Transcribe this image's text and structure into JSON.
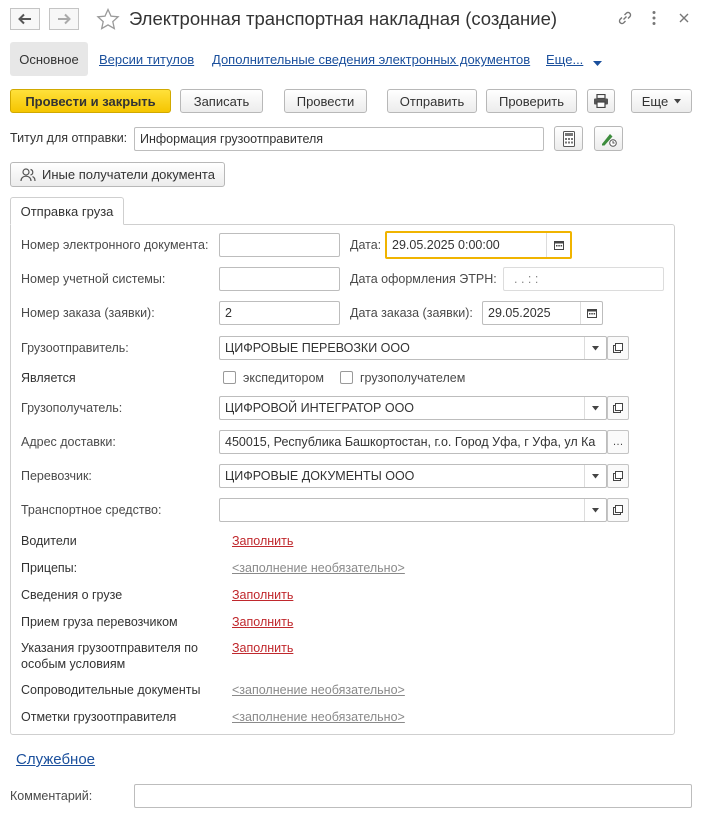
{
  "window": {
    "title": "Электронная транспортная накладная (создание)"
  },
  "tabs": {
    "main": "Основное",
    "links": [
      "Версии титулов",
      "Дополнительные сведения электронных документов",
      "Еще..."
    ]
  },
  "toolbar": {
    "post_close": "Провести и закрыть",
    "write": "Записать",
    "post": "Провести",
    "send": "Отправить",
    "check": "Проверить",
    "more": "Еще"
  },
  "title_row": {
    "label": "Титул для отправки:",
    "value": "Информация грузоотправителя"
  },
  "other_recipients": "Иные получатели документа",
  "section_tab": "Отправка груза",
  "form": {
    "doc_number_label": "Номер электронного документа:",
    "doc_number_value": "",
    "date_label": "Дата:",
    "date_value": "29.05.2025  0:00:00",
    "account_number_label": "Номер учетной системы:",
    "account_number_value": "",
    "etrn_date_label": "Дата оформления ЭТРН:",
    "etrn_date_value": " .  .       :  :",
    "order_number_label": "Номер заказа (заявки):",
    "order_number_value": "2",
    "order_date_label": "Дата заказа (заявки):",
    "order_date_value": "29.05.2025",
    "shipper_label": "Грузоотправитель:",
    "shipper_value": "ЦИФРОВЫЕ ПЕРЕВОЗКИ ООО",
    "is_label": "Является",
    "forwarder_label": "экспедитором",
    "forwarder_checked": false,
    "consignee_flag_label": "грузополучателем",
    "consignee_flag_checked": false,
    "consignee_label": "Грузополучатель:",
    "consignee_value": "ЦИФРОВОЙ ИНТЕГРАТОР ООО",
    "address_label": "Адрес доставки:",
    "address_value": "450015, Республика Башкортостан, г.о. Город Уфа, г Уфа, ул Ка",
    "carrier_label": "Перевозчик:",
    "carrier_value": "ЦИФРОВЫЕ ДОКУМЕНТЫ ООО",
    "vehicle_label": "Транспортное средство:",
    "vehicle_value": "",
    "drivers_label": "Водители",
    "drivers_link": "Заполнить",
    "trailers_label": "Прицепы:",
    "trailers_link": "<заполнение необязательно>",
    "cargo_label": "Сведения о грузе",
    "cargo_link": "Заполнить",
    "acceptance_label": "Прием груза перевозчиком",
    "acceptance_link": "Заполнить",
    "instructions_label_1": "Указания грузоотправителя по",
    "instructions_label_2": "особым условиям",
    "instructions_link": "Заполнить",
    "accompanying_label": "Сопроводительные документы",
    "accompanying_link": "<заполнение необязательно>",
    "marks_label": "Отметки грузоотправителя",
    "marks_link": "<заполнение необязательно>"
  },
  "service_link": "Служебное",
  "comment": {
    "label": "Комментарий:",
    "value": ""
  },
  "colors": {
    "primary_button": "#f5c500",
    "link_blue": "#1a4f9c",
    "link_red": "#c0282d",
    "focus_border": "#f0b400"
  },
  "icons": [
    "back-arrow-icon",
    "forward-arrow-icon",
    "star-icon",
    "link-icon",
    "kebab-menu-icon",
    "close-icon",
    "printer-icon",
    "calculator-icon",
    "edit-signature-icon",
    "people-icon",
    "calendar-icon",
    "open-form-icon",
    "chevron-down-icon"
  ]
}
